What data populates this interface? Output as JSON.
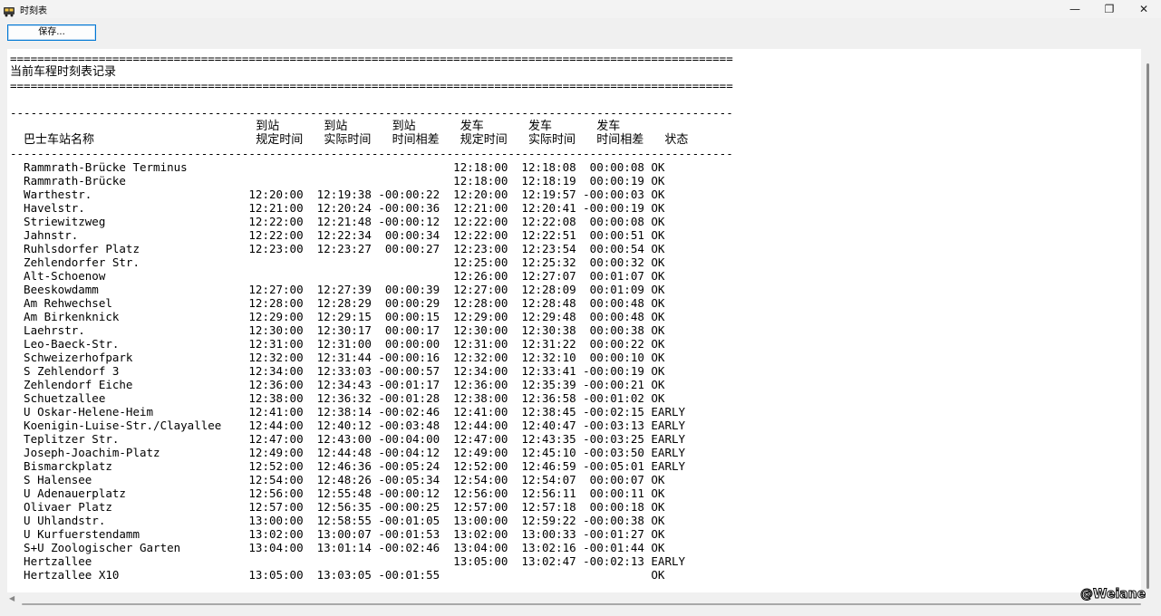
{
  "window": {
    "title": "时刻表",
    "controls": {
      "minimize": "—",
      "maximize": "❐",
      "close": "✕"
    }
  },
  "toolbar": {
    "save_label": "保存..."
  },
  "report": {
    "rule_double": "==========================================================================================================",
    "rule_single": "----------------------------------------------------------------------------------------------------------",
    "heading": "当前车程时刻表记录",
    "header_top": [
      "到站",
      "到站",
      "到站",
      "发车",
      "发车",
      "发车"
    ],
    "header_bottom": [
      "巴士车站名称",
      "规定时间",
      "实际时间",
      "时间相差",
      "规定时间",
      "实际时间",
      "时间相差",
      "状态"
    ],
    "rows": [
      [
        "Rammrath-Brücke Terminus",
        "",
        "",
        "",
        "12:18:00",
        "12:18:08",
        " 00:00:08",
        "OK"
      ],
      [
        "Rammrath-Brücke",
        "",
        "",
        "",
        "12:18:00",
        "12:18:19",
        " 00:00:19",
        "OK"
      ],
      [
        "Warthestr.",
        "12:20:00",
        "12:19:38",
        "-00:00:22",
        "12:20:00",
        "12:19:57",
        "-00:00:03",
        "OK"
      ],
      [
        "Havelstr.",
        "12:21:00",
        "12:20:24",
        "-00:00:36",
        "12:21:00",
        "12:20:41",
        "-00:00:19",
        "OK"
      ],
      [
        "Striewitzweg",
        "12:22:00",
        "12:21:48",
        "-00:00:12",
        "12:22:00",
        "12:22:08",
        " 00:00:08",
        "OK"
      ],
      [
        "Jahnstr.",
        "12:22:00",
        "12:22:34",
        " 00:00:34",
        "12:22:00",
        "12:22:51",
        " 00:00:51",
        "OK"
      ],
      [
        "Ruhlsdorfer Platz",
        "12:23:00",
        "12:23:27",
        " 00:00:27",
        "12:23:00",
        "12:23:54",
        " 00:00:54",
        "OK"
      ],
      [
        "Zehlendorfer Str.",
        "",
        "",
        "",
        "12:25:00",
        "12:25:32",
        " 00:00:32",
        "OK"
      ],
      [
        "Alt-Schoenow",
        "",
        "",
        "",
        "12:26:00",
        "12:27:07",
        " 00:01:07",
        "OK"
      ],
      [
        "Beeskowdamm",
        "12:27:00",
        "12:27:39",
        " 00:00:39",
        "12:27:00",
        "12:28:09",
        " 00:01:09",
        "OK"
      ],
      [
        "Am Rehwechsel",
        "12:28:00",
        "12:28:29",
        " 00:00:29",
        "12:28:00",
        "12:28:48",
        " 00:00:48",
        "OK"
      ],
      [
        "Am Birkenknick",
        "12:29:00",
        "12:29:15",
        " 00:00:15",
        "12:29:00",
        "12:29:48",
        " 00:00:48",
        "OK"
      ],
      [
        "Laehrstr.",
        "12:30:00",
        "12:30:17",
        " 00:00:17",
        "12:30:00",
        "12:30:38",
        " 00:00:38",
        "OK"
      ],
      [
        "Leo-Baeck-Str.",
        "12:31:00",
        "12:31:00",
        " 00:00:00",
        "12:31:00",
        "12:31:22",
        " 00:00:22",
        "OK"
      ],
      [
        "Schweizerhofpark",
        "12:32:00",
        "12:31:44",
        "-00:00:16",
        "12:32:00",
        "12:32:10",
        " 00:00:10",
        "OK"
      ],
      [
        "S Zehlendorf 3",
        "12:34:00",
        "12:33:03",
        "-00:00:57",
        "12:34:00",
        "12:33:41",
        "-00:00:19",
        "OK"
      ],
      [
        "Zehlendorf Eiche",
        "12:36:00",
        "12:34:43",
        "-00:01:17",
        "12:36:00",
        "12:35:39",
        "-00:00:21",
        "OK"
      ],
      [
        "Schuetzallee",
        "12:38:00",
        "12:36:32",
        "-00:01:28",
        "12:38:00",
        "12:36:58",
        "-00:01:02",
        "OK"
      ],
      [
        "U Oskar-Helene-Heim",
        "12:41:00",
        "12:38:14",
        "-00:02:46",
        "12:41:00",
        "12:38:45",
        "-00:02:15",
        "EARLY"
      ],
      [
        "Koenigin-Luise-Str./Clayallee",
        "12:44:00",
        "12:40:12",
        "-00:03:48",
        "12:44:00",
        "12:40:47",
        "-00:03:13",
        "EARLY"
      ],
      [
        "Teplitzer Str.",
        "12:47:00",
        "12:43:00",
        "-00:04:00",
        "12:47:00",
        "12:43:35",
        "-00:03:25",
        "EARLY"
      ],
      [
        "Joseph-Joachim-Platz",
        "12:49:00",
        "12:44:48",
        "-00:04:12",
        "12:49:00",
        "12:45:10",
        "-00:03:50",
        "EARLY"
      ],
      [
        "Bismarckplatz",
        "12:52:00",
        "12:46:36",
        "-00:05:24",
        "12:52:00",
        "12:46:59",
        "-00:05:01",
        "EARLY"
      ],
      [
        "S Halensee",
        "12:54:00",
        "12:48:26",
        "-00:05:34",
        "12:54:00",
        "12:54:07",
        " 00:00:07",
        "OK"
      ],
      [
        "U Adenauerplatz",
        "12:56:00",
        "12:55:48",
        "-00:00:12",
        "12:56:00",
        "12:56:11",
        " 00:00:11",
        "OK"
      ],
      [
        "Olivaer Platz",
        "12:57:00",
        "12:56:35",
        "-00:00:25",
        "12:57:00",
        "12:57:18",
        " 00:00:18",
        "OK"
      ],
      [
        "U Uhlandstr.",
        "13:00:00",
        "12:58:55",
        "-00:01:05",
        "13:00:00",
        "12:59:22",
        "-00:00:38",
        "OK"
      ],
      [
        "U Kurfuerstendamm",
        "13:02:00",
        "13:00:07",
        "-00:01:53",
        "13:02:00",
        "13:00:33",
        "-00:01:27",
        "OK"
      ],
      [
        "S+U Zoologischer Garten",
        "13:04:00",
        "13:01:14",
        "-00:02:46",
        "13:04:00",
        "13:02:16",
        "-00:01:44",
        "OK"
      ],
      [
        "Hertzallee",
        "",
        "",
        "",
        "13:05:00",
        "13:02:47",
        "-00:02:13",
        "EARLY"
      ],
      [
        "Hertzallee X10",
        "13:05:00",
        "13:03:05",
        "-00:01:55",
        "",
        "",
        "",
        "OK"
      ]
    ]
  },
  "watermark": "@Weiane"
}
